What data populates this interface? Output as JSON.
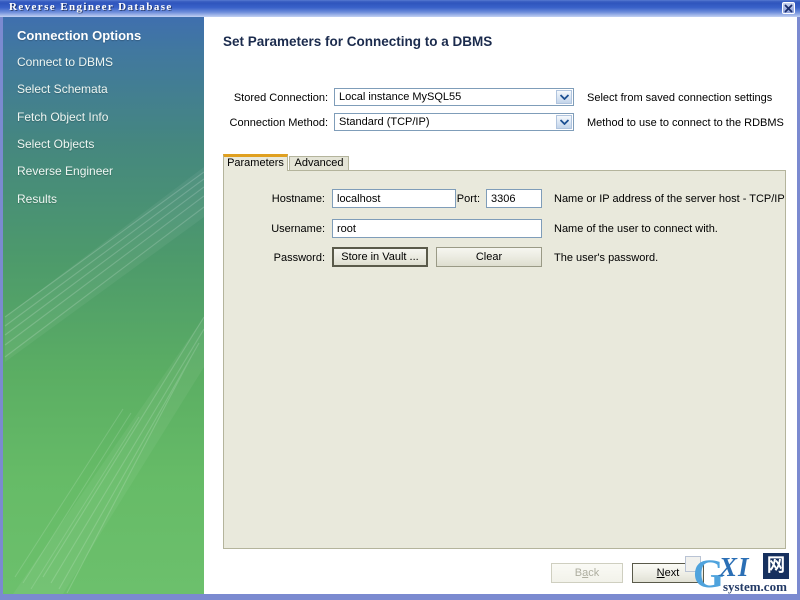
{
  "window": {
    "title": "Reverse Engineer Database",
    "close_icon": "close-icon"
  },
  "sidebar": {
    "items": [
      {
        "label": "Connection Options",
        "active": true
      },
      {
        "label": "Connect to DBMS",
        "active": false
      },
      {
        "label": "Select Schemata",
        "active": false
      },
      {
        "label": "Fetch Object Info",
        "active": false
      },
      {
        "label": "Select Objects",
        "active": false
      },
      {
        "label": "Reverse Engineer",
        "active": false
      },
      {
        "label": "Results",
        "active": false
      }
    ]
  },
  "main": {
    "page_title": "Set Parameters for Connecting to a DBMS",
    "stored_connection": {
      "label": "Stored Connection:",
      "value": "Local instance MySQL55",
      "hint": "Select from saved connection settings"
    },
    "connection_method": {
      "label": "Connection Method:",
      "value": "Standard (TCP/IP)",
      "hint": "Method to use to connect to the RDBMS"
    },
    "tabs": [
      {
        "label": "Parameters",
        "selected": true
      },
      {
        "label": "Advanced",
        "selected": false
      }
    ],
    "parameters": {
      "hostname": {
        "label": "Hostname:",
        "value": "localhost",
        "hint": "Name or IP address of the server host - TCP/IP port"
      },
      "port": {
        "label": "Port:",
        "value": "3306"
      },
      "username": {
        "label": "Username:",
        "value": "root",
        "hint": "Name of the user to connect with."
      },
      "password": {
        "label": "Password:",
        "store_button": "Store in Vault ...",
        "clear_button": "Clear",
        "hint": "The user's password."
      }
    }
  },
  "footer": {
    "back_button": {
      "prefix": "B",
      "accel": "a",
      "suffix": "ck",
      "disabled": true
    },
    "next_button": {
      "prefix": "",
      "accel": "N",
      "suffix": "ext",
      "disabled": false
    }
  },
  "watermark": {
    "g": "G",
    "xi": "XI",
    "net": "网",
    "sub": "system.com"
  },
  "colors": {
    "titlebar_blue": "#2f55bd",
    "frame_blue": "#7b8ad0",
    "sidebar_top": "#3f6fae",
    "sidebar_bottom": "#6cc06c",
    "panel_beige": "#e9e9dc",
    "tab_accent": "#e0a020",
    "heading_navy": "#1b2b4d"
  }
}
